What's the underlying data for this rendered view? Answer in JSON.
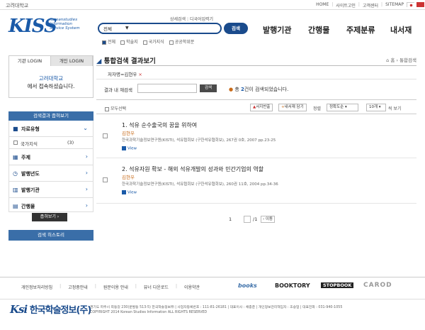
{
  "header": {
    "institution": "고려대학교",
    "top_links": [
      "HOME",
      "사이트고인",
      "고객센터",
      "SITEMAP"
    ],
    "logo_text": "KISS",
    "logo_subtitle": [
      "Koreanstudies",
      "Information",
      "Service System"
    ],
    "search_links": [
      "상세검색",
      "디국어입력기"
    ],
    "search_scope": "전체",
    "search_value": "",
    "search_button": "검색",
    "filters": [
      {
        "label": "전체",
        "checked": true
      },
      {
        "label": "학술지",
        "checked": false
      },
      {
        "label": "국가지식",
        "checked": false
      },
      {
        "label": "공공학위문",
        "checked": false
      }
    ],
    "nav": [
      "발행기관",
      "간행물",
      "주제분류",
      "내서재"
    ],
    "colors": {
      "brand": "#1a4b8c",
      "accent": "#3a6ea8",
      "author": "#c86b1a"
    }
  },
  "sidebar": {
    "tabs": [
      "기관 LOGIN",
      "개인 LOGIN"
    ],
    "login_org": "고려대학교",
    "login_msg": "에서 접속하셨습니다.",
    "narrow_title": "검색결과 좁혀보기",
    "facets": [
      {
        "icon": "document-icon",
        "label": "자료유형"
      },
      {
        "icon": "grid-icon",
        "label": "주제"
      },
      {
        "icon": "clock-icon",
        "label": "발행년도"
      },
      {
        "icon": "building-icon",
        "label": "발행기관"
      },
      {
        "icon": "book-icon",
        "label": "간행물"
      }
    ],
    "facet_sub": {
      "label": "국가지식",
      "count": "(3)"
    },
    "narrow_button": "좁혀보기",
    "history_button": "검색 히스토리"
  },
  "main": {
    "title": "통합검색 결과보기",
    "breadcrumb": [
      "홈",
      "통합검색"
    ],
    "chip": "저자명=김현우",
    "refine_label": "결과 내 재검색",
    "refine_value": "",
    "refine_button": "검색",
    "count_pre": "총 ",
    "count": "2",
    "count_post": "건이 검색되었습니다.",
    "select_all": "모두선택",
    "tools": [
      "서지반출",
      "내서재 담기"
    ],
    "sort_label": "정렬",
    "sort_value": "정확도순",
    "per_page": "10개",
    "per_page_suffix": "씩 보기",
    "results": [
      {
        "title": "1. 석유 순수출국의 꿈을 위하여",
        "author": "김현우",
        "source": "한국과학기술정보연구원(KISTI), 석유협회보 (구한석유협회보), 267권 0호, 2007 pp.23-25",
        "view": "View"
      },
      {
        "title": "2. 석유자원 확보 - 해외 석유개발의 성과와 민간기업의 역할",
        "author": "김현우",
        "source": "한국과학기술정보연구원(KISTI), 석유협회보 (구한석유협회보), 260권 11호, 2004 pp.34-36",
        "view": "View"
      }
    ],
    "pagination": {
      "page": "1",
      "total": "/1",
      "next": "이동"
    }
  },
  "footer": {
    "links": [
      "개인정보처리방침",
      "고정중안내",
      "원문이용 안내",
      "뷰너 다운로드",
      "이용약관"
    ],
    "partners": [
      "books",
      "BOOKTORY",
      "STOPBOOK",
      "CAROD"
    ],
    "logo": "한국학술정보(주)",
    "address": "경기도 파주시 회동길 230(문발동 513-5) 한국학술정보㈜ | 사업자등록번호 : 111-81-26181 | 대표이사 : 채종준 | 개인정보관리책임자 : 조승업 | 대표전화 : 031-940-1055",
    "copyright": "COPYRIGHT 2014 Korean Studies Information ALL RIGHTS RESERVED"
  }
}
